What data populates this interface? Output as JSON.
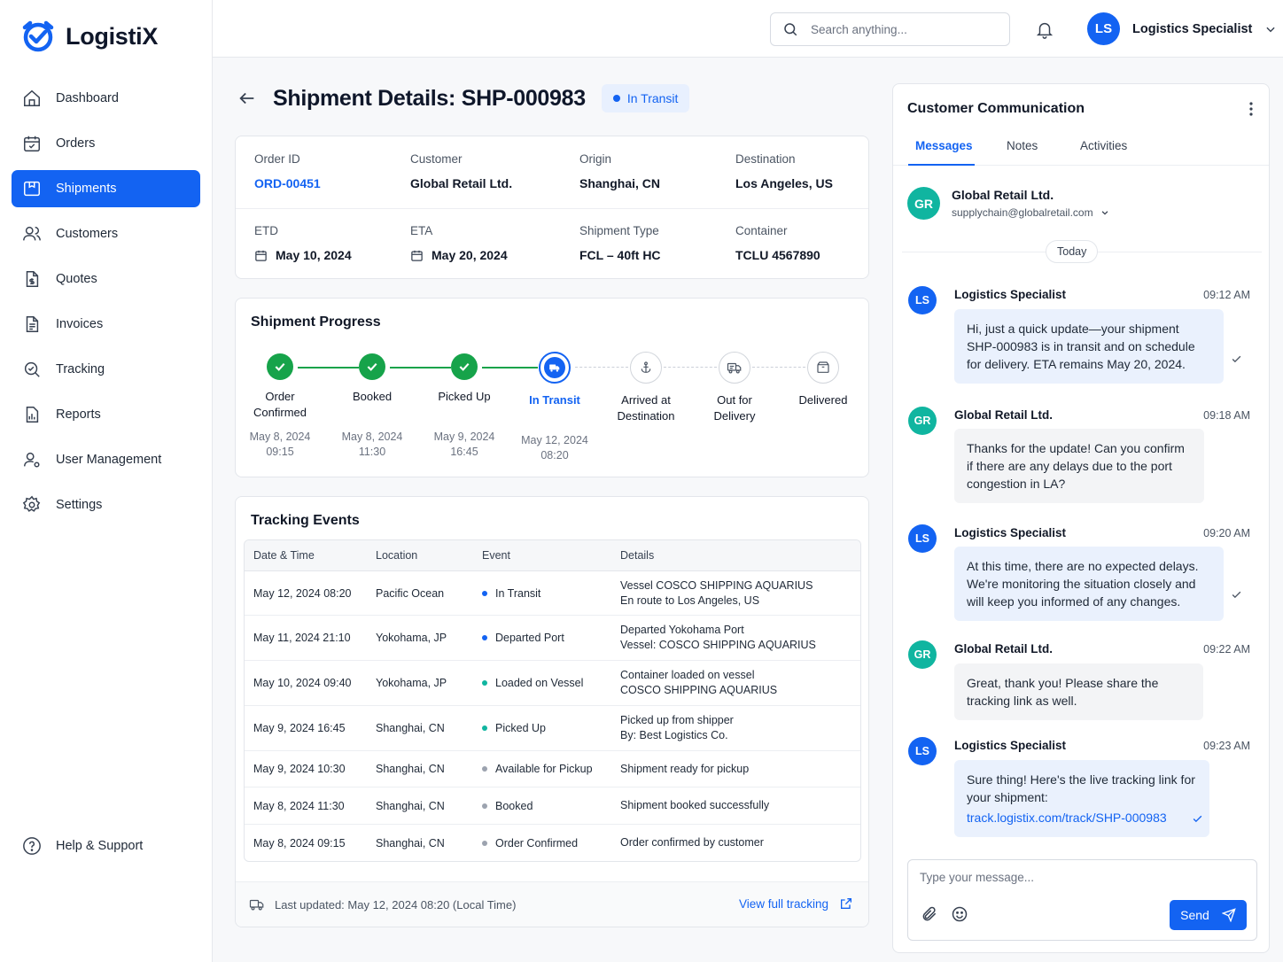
{
  "app": {
    "name": "LogistiX"
  },
  "sidebar": {
    "items": [
      {
        "label": "Dashboard"
      },
      {
        "label": "Orders"
      },
      {
        "label": "Shipments"
      },
      {
        "label": "Customers"
      },
      {
        "label": "Quotes"
      },
      {
        "label": "Invoices"
      },
      {
        "label": "Tracking"
      },
      {
        "label": "Reports"
      },
      {
        "label": "User Management"
      },
      {
        "label": "Settings"
      }
    ],
    "active": "Shipments",
    "help_label": "Help & Support"
  },
  "header": {
    "search_placeholder": "Search anything...",
    "user_initials": "LS",
    "user_name": "Logistics Specialist"
  },
  "page": {
    "title": "Shipment Details: SHP-000983",
    "status": "In Transit"
  },
  "details": {
    "order_id_label": "Order ID",
    "order_id": "ORD-00451",
    "customer_label": "Customer",
    "customer": "Global Retail Ltd.",
    "origin_label": "Origin",
    "origin": "Shanghai, CN",
    "destination_label": "Destination",
    "destination": "Los Angeles, US",
    "etd_label": "ETD",
    "etd": "May 10, 2024",
    "eta_label": "ETA",
    "eta": "May 20, 2024",
    "type_label": "Shipment Type",
    "type": "FCL – 40ft HC",
    "container_label": "Container",
    "container": "TCLU 4567890"
  },
  "progress": {
    "title": "Shipment Progress",
    "steps": [
      {
        "line1": "Order",
        "line2": "Confirmed",
        "date": "May 8, 2024",
        "time": "09:15",
        "state": "done"
      },
      {
        "line1": "Booked",
        "line2": "",
        "date": "May 8, 2024",
        "time": "11:30",
        "state": "done"
      },
      {
        "line1": "Picked Up",
        "line2": "",
        "date": "May 9, 2024",
        "time": "16:45",
        "state": "done"
      },
      {
        "line1": "In Transit",
        "line2": "",
        "date": "May 12, 2024",
        "time": "08:20",
        "state": "current"
      },
      {
        "line1": "Arrived at",
        "line2": "Destination",
        "date": "",
        "time": "",
        "state": "pending"
      },
      {
        "line1": "Out for",
        "line2": "Delivery",
        "date": "",
        "time": "",
        "state": "pending"
      },
      {
        "line1": "Delivered",
        "line2": "",
        "date": "",
        "time": "",
        "state": "pending"
      }
    ]
  },
  "events": {
    "title": "Tracking Events",
    "columns": [
      "Date & Time",
      "Location",
      "Event",
      "Details"
    ],
    "rows": [
      {
        "datetime": "May 12, 2024 08:20",
        "location": "Pacific Ocean",
        "event": "In Transit",
        "dot": "#1363f2",
        "detail1": "Vessel COSCO SHIPPING AQUARIUS",
        "detail2": "En route to Los Angeles, US"
      },
      {
        "datetime": "May 11, 2024 21:10",
        "location": "Yokohama, JP",
        "event": "Departed Port",
        "dot": "#1363f2",
        "detail1": "Departed Yokohama Port",
        "detail2": "Vessel: COSCO SHIPPING AQUARIUS"
      },
      {
        "datetime": "May 10, 2024 09:40",
        "location": "Yokohama, JP",
        "event": "Loaded on Vessel",
        "dot": "#10b5a0",
        "detail1": "Container loaded on vessel",
        "detail2": "COSCO SHIPPING AQUARIUS"
      },
      {
        "datetime": "May 9, 2024 16:45",
        "location": "Shanghai, CN",
        "event": "Picked Up",
        "dot": "#10b5a0",
        "detail1": "Picked up from shipper",
        "detail2": "By: Best Logistics Co."
      },
      {
        "datetime": "May 9, 2024 10:30",
        "location": "Shanghai, CN",
        "event": "Available for Pickup",
        "dot": "#9ca3af",
        "detail1": "Shipment ready for pickup",
        "detail2": ""
      },
      {
        "datetime": "May 8, 2024 11:30",
        "location": "Shanghai, CN",
        "event": "Booked",
        "dot": "#9ca3af",
        "detail1": "Shipment booked successfully",
        "detail2": ""
      },
      {
        "datetime": "May 8, 2024 09:15",
        "location": "Shanghai, CN",
        "event": "Order Confirmed",
        "dot": "#9ca3af",
        "detail1": "Order confirmed by customer",
        "detail2": ""
      }
    ],
    "last_updated": "Last updated: May 12, 2024 08:20 (Local Time)",
    "view_full": "View full tracking"
  },
  "comm": {
    "title": "Customer Communication",
    "tabs": [
      "Messages",
      "Notes",
      "Activities"
    ],
    "contact": {
      "initials": "GR",
      "name": "Global Retail Ltd.",
      "email": "supplychain@globalretail.com"
    },
    "day_label": "Today",
    "messages": [
      {
        "initials": "LS",
        "sender": "Logistics Specialist",
        "time": "09:12 AM",
        "lines": [
          "Hi, just a quick update—your shipment",
          "SHP-000983 is in transit and on schedule",
          "for delivery. ETA remains May 20, 2024."
        ]
      },
      {
        "initials": "GR",
        "sender": "Global Retail Ltd.",
        "time": "09:18 AM",
        "lines": [
          "Thanks for the update! Can you confirm",
          "if there are any delays due to the port",
          "congestion in LA?"
        ]
      },
      {
        "initials": "LS",
        "sender": "Logistics Specialist",
        "time": "09:20 AM",
        "lines": [
          "At this time, there are no expected delays.",
          "We're monitoring the situation closely and",
          "will keep you informed of any changes."
        ]
      },
      {
        "initials": "GR",
        "sender": "Global Retail Ltd.",
        "time": "09:22 AM",
        "lines": [
          "Great, thank you! Please share the",
          "tracking link as well."
        ]
      },
      {
        "initials": "LS",
        "sender": "Logistics Specialist",
        "time": "09:23 AM",
        "lines": [
          "Sure thing! Here's the live tracking link for",
          "your shipment:"
        ],
        "link": "track.logistix.com/track/SHP-000983"
      }
    ],
    "composer_placeholder": "Type your message...",
    "send_label": "Send"
  },
  "colors": {
    "primary": "#1363f2",
    "success": "#16a34a",
    "teal": "#10b5a0"
  }
}
